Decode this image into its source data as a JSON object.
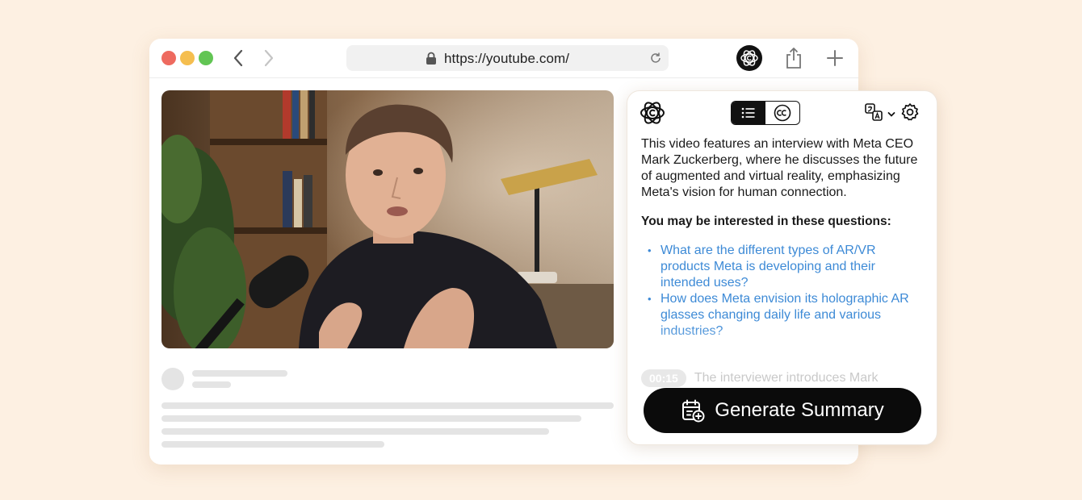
{
  "browser": {
    "url": "https://youtube.com/",
    "icons": [
      "back-icon",
      "forward-icon",
      "lock-icon",
      "reload-icon",
      "extension-logo-icon",
      "share-icon",
      "new-tab-icon"
    ]
  },
  "video": {
    "description_hidden": ""
  },
  "panel": {
    "summary": "This video features an interview with Meta CEO Mark Zuckerberg, where he discusses the future of augmented and virtual reality, emphasizing Meta's vision for human connection.",
    "questions_title": "You may be interested in these questions:",
    "questions": [
      "What are the different types of AR/VR products Meta is developing and their intended uses?",
      "How does Meta envision its holographic AR glasses changing daily life and various industries?"
    ],
    "timestamp": "00:15",
    "timestamp_text": "The interviewer introduces Mark",
    "generate_button": "Generate Summary"
  },
  "colors": {
    "background": "#fdf0e2",
    "accent_link": "#3d8ad6",
    "button": "#0b0b0b"
  }
}
